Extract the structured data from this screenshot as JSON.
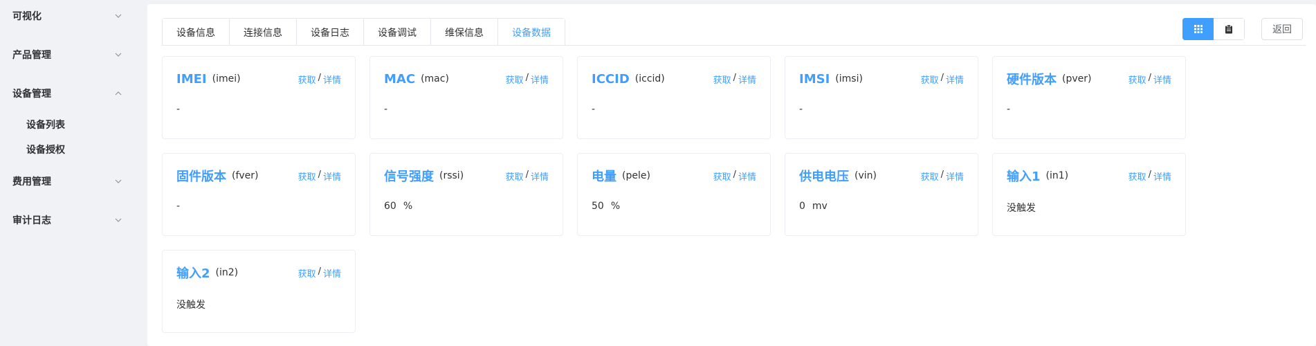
{
  "sidebar": {
    "items": [
      {
        "label": "可视化",
        "expanded": false
      },
      {
        "label": "产品管理",
        "expanded": false
      },
      {
        "label": "设备管理",
        "expanded": true
      },
      {
        "label": "费用管理",
        "expanded": false
      },
      {
        "label": "审计日志",
        "expanded": false
      }
    ],
    "sub_items": [
      {
        "label": "设备列表"
      },
      {
        "label": "设备授权"
      }
    ]
  },
  "tabs": [
    {
      "label": "设备信息",
      "active": false
    },
    {
      "label": "连接信息",
      "active": false
    },
    {
      "label": "设备日志",
      "active": false
    },
    {
      "label": "设备调试",
      "active": false
    },
    {
      "label": "维保信息",
      "active": false
    },
    {
      "label": "设备数据",
      "active": true
    }
  ],
  "toolbar": {
    "grid_icon": "grid-icon",
    "list_icon": "document-icon",
    "back_label": "返回"
  },
  "actions": {
    "fetch": "获取",
    "sep": "/",
    "detail": "详情"
  },
  "cards": [
    {
      "title": "IMEI",
      "key": "(imei)",
      "value": "-",
      "unit": ""
    },
    {
      "title": "MAC",
      "key": "(mac)",
      "value": "-",
      "unit": ""
    },
    {
      "title": "ICCID",
      "key": "(iccid)",
      "value": "-",
      "unit": ""
    },
    {
      "title": "IMSI",
      "key": "(imsi)",
      "value": "-",
      "unit": ""
    },
    {
      "title": "硬件版本",
      "key": "(pver)",
      "value": "-",
      "unit": ""
    },
    {
      "title": "固件版本",
      "key": "(fver)",
      "value": "-",
      "unit": ""
    },
    {
      "title": "信号强度",
      "key": "(rssi)",
      "value": "60",
      "unit": "%"
    },
    {
      "title": "电量",
      "key": "(pele)",
      "value": "50",
      "unit": "%"
    },
    {
      "title": "供电电压",
      "key": "(vin)",
      "value": "0",
      "unit": "mv"
    },
    {
      "title": "输入1",
      "key": "(in1)",
      "value": "没触发",
      "unit": ""
    },
    {
      "title": "输入2",
      "key": "(in2)",
      "value": "没触发",
      "unit": ""
    }
  ],
  "colors": {
    "accent": "#409eff",
    "text": "#303133",
    "border": "#ebeef5"
  }
}
